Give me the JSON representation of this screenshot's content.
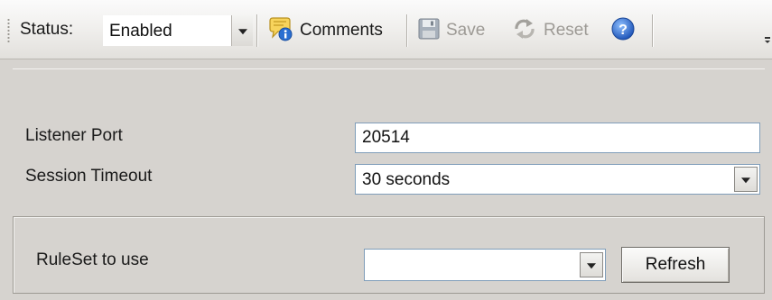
{
  "toolbar": {
    "status_label": "Status:",
    "status_value": "Enabled",
    "comments_label": "Comments",
    "save_label": "Save",
    "reset_label": "Reset",
    "comments_icon": "comments-icon",
    "save_icon": "save-icon",
    "reset_icon": "reset-icon",
    "help_icon": "help-icon"
  },
  "form": {
    "listener_port_label": "Listener Port",
    "listener_port_value": "20514",
    "session_timeout_label": "Session Timeout",
    "session_timeout_value": "30 seconds"
  },
  "ruleset": {
    "label": "RuleSet to use",
    "value": "",
    "refresh_label": "Refresh"
  },
  "colors": {
    "background": "#d6d3cf",
    "input_border": "#7f9db9",
    "help_blue": "#2d64c8",
    "disabled_text": "#9d9a95"
  }
}
